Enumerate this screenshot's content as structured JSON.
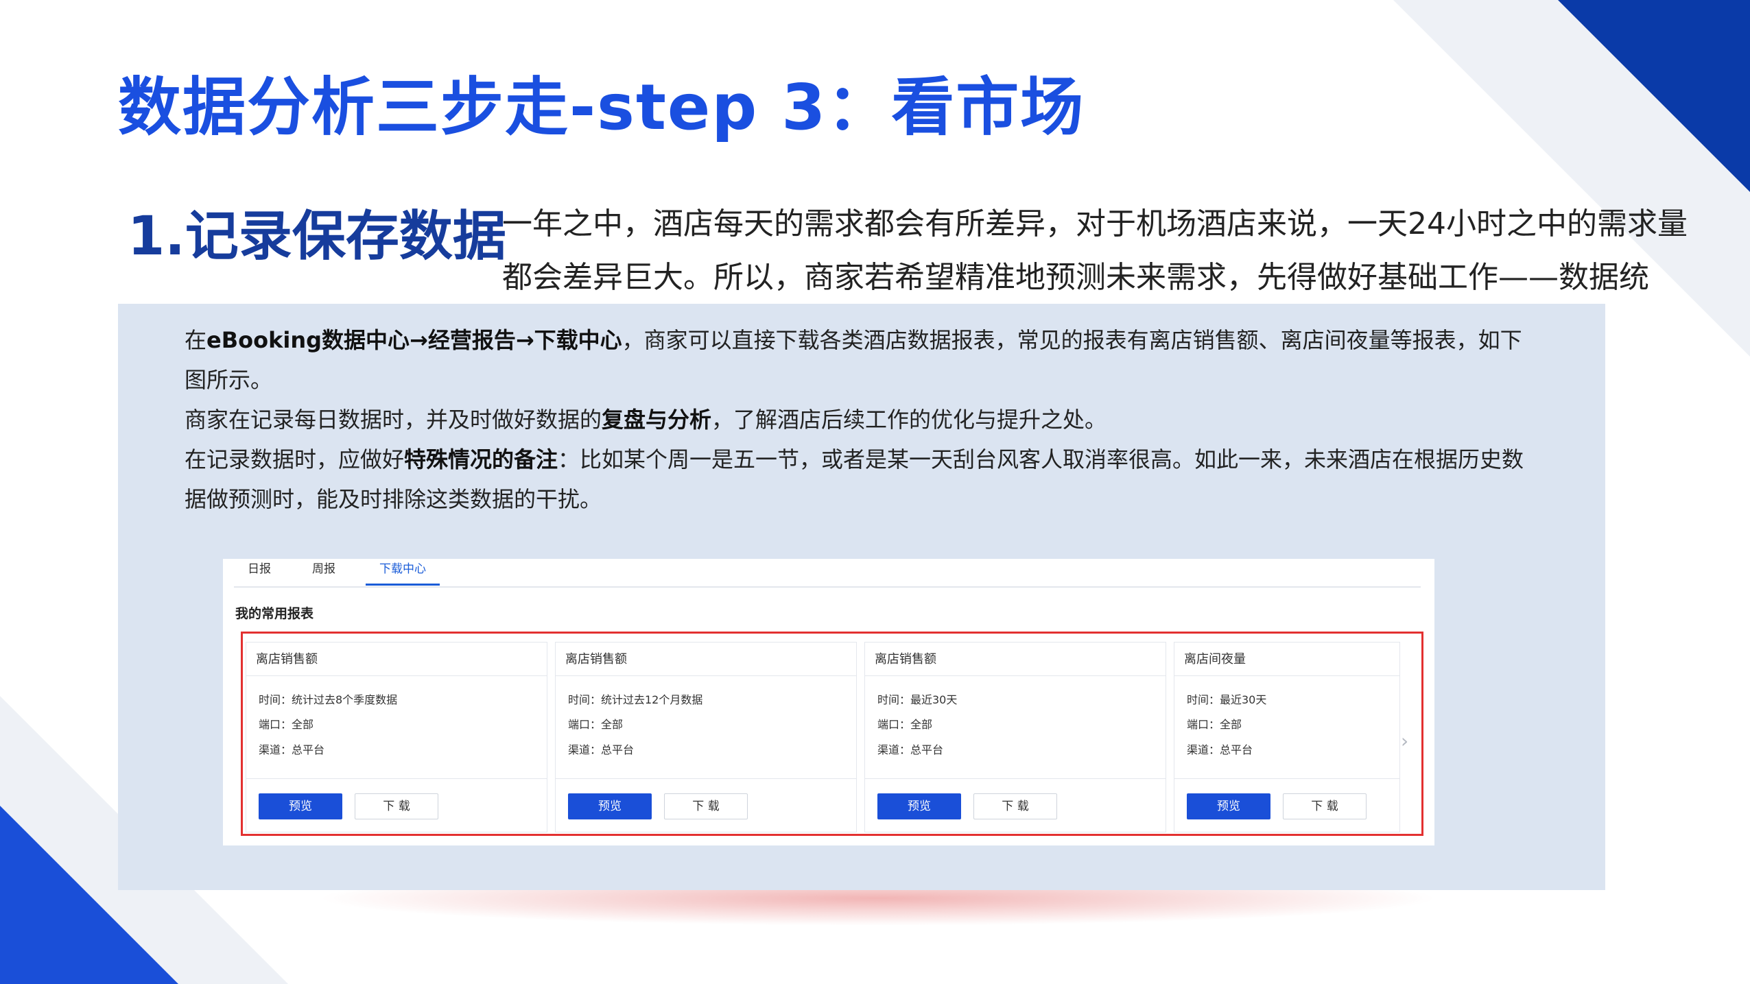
{
  "title": "数据分析三步走-step 3：看市场",
  "section": {
    "heading": "1.记录保存数据",
    "intro": "一年之中，酒店每天的需求都会有所差异，对于机场酒店来说，一天24小时之中的需求量都会差异巨大。所以，商家若希望精准地预测未来需求，先得做好基础工作——数据统计。"
  },
  "panel": {
    "p1_pre": "在",
    "p1_bold": "eBooking数据中心→经营报告→下载中心",
    "p1_post": "，商家可以直接下载各类酒店数据报表，常见的报表有离店销售额、离店间夜量等报表，如下图所示。",
    "p2_pre": "商家在记录每日数据时，并及时做好数据的",
    "p2_bold": "复盘与分析",
    "p2_post": "，了解酒店后续工作的优化与提升之处。",
    "p3_pre": "在记录数据时，应做好",
    "p3_bold": "特殊情况的备注",
    "p3_post": "：比如某个周一是五一节，或者是某一天刮台风客人取消率很高。如此一来，未来酒店在根据历史数据做预测时，能及时排除这类数据的干扰。"
  },
  "screenshot": {
    "tabs": [
      "日报",
      "周报",
      "下载中心"
    ],
    "active_tab": "下载中心",
    "section_label": "我的常用报表",
    "cards": [
      {
        "title": "离店销售额",
        "time": "时间：统计过去8个季度数据",
        "port": "端口：全部",
        "channel": "渠道：总平台",
        "preview": "预览",
        "download": "下 载"
      },
      {
        "title": "离店销售额",
        "time": "时间：统计过去12个月数据",
        "port": "端口：全部",
        "channel": "渠道：总平台",
        "preview": "预览",
        "download": "下 载"
      },
      {
        "title": "离店销售额",
        "time": "时间：最近30天",
        "port": "端口：全部",
        "channel": "渠道：总平台",
        "preview": "预览",
        "download": "下 载"
      },
      {
        "title": "离店间夜量",
        "time": "时间：最近30天",
        "port": "端口：全部",
        "channel": "渠道：总平台",
        "preview": "预览",
        "download": "下 载"
      }
    ],
    "next_icon": "chevron-right-icon"
  },
  "colors": {
    "title_blue": "#1a4fe0",
    "heading_blue": "#163c9c",
    "panel_bg": "#dbe4f1",
    "primary_button": "#1a4fd8",
    "highlight_border": "#e33030"
  }
}
